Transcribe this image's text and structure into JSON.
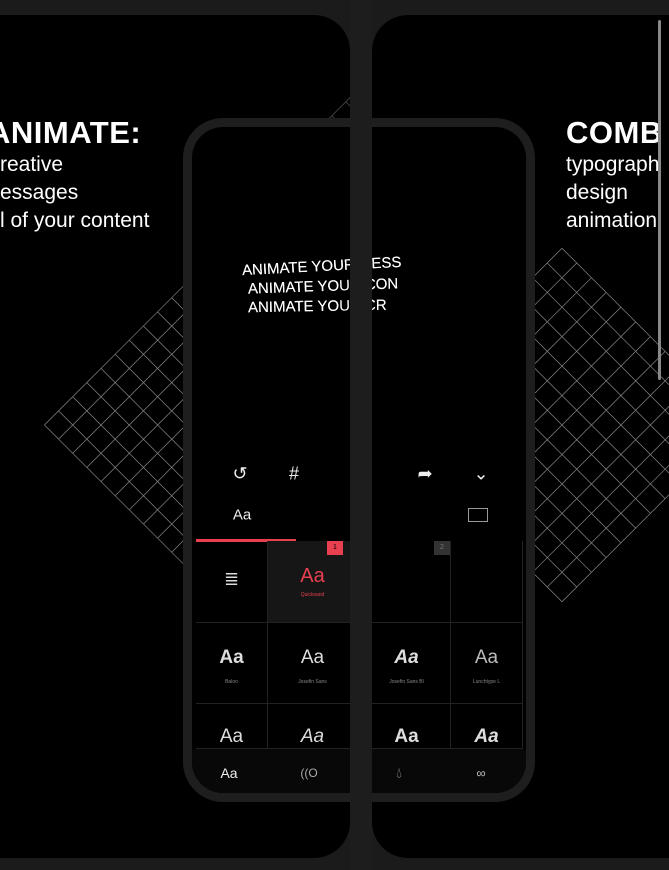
{
  "left": {
    "heading": "ANIMATE:",
    "lines": [
      "reative",
      "essages",
      "l of your content"
    ]
  },
  "right": {
    "heading": "COMB",
    "lines": [
      "typograph",
      "design",
      "animation"
    ]
  },
  "preview": {
    "lines": [
      "ANIMATE YOUR MESS",
      "ANIMATE YOUR CON",
      "ANIMATE YOUR CR"
    ],
    "left_lines": [
      "ANIMATE YOU",
      "ANIMATE YO",
      "ANIMATE YO"
    ],
    "right_lines": [
      "R MESS",
      "R CON",
      "R CR"
    ]
  },
  "toolbar": {
    "icons": [
      "undo-icon",
      "grid-icon",
      "layers-icon",
      "share-icon",
      "chevron-down-icon"
    ]
  },
  "tabs": [
    {
      "label": "Aa"
    },
    {
      "icon": "waves-icon"
    },
    {
      "icon": "image-icon"
    }
  ],
  "fonts": {
    "badges": [
      "1",
      "2"
    ],
    "selected": {
      "label": "Aa",
      "name": "Quicksand"
    },
    "cells": [
      {
        "label": "Aa",
        "name": "Baloo"
      },
      {
        "label": "Aa",
        "name": "Josefin Sans"
      },
      {
        "label": "Aa",
        "name": "Josefin Sans Bl"
      },
      {
        "label": "Aa",
        "name": "Lunchtype L"
      }
    ],
    "row3": [
      "Aa",
      "Aa",
      "Aa",
      "Aa"
    ]
  },
  "bottom_nav": {
    "label": "Aa",
    "icons": [
      "text-icon",
      "animation-icon",
      "color-drop-icon",
      "blend-icon"
    ]
  },
  "colors": {
    "accent": "#e8404f"
  }
}
